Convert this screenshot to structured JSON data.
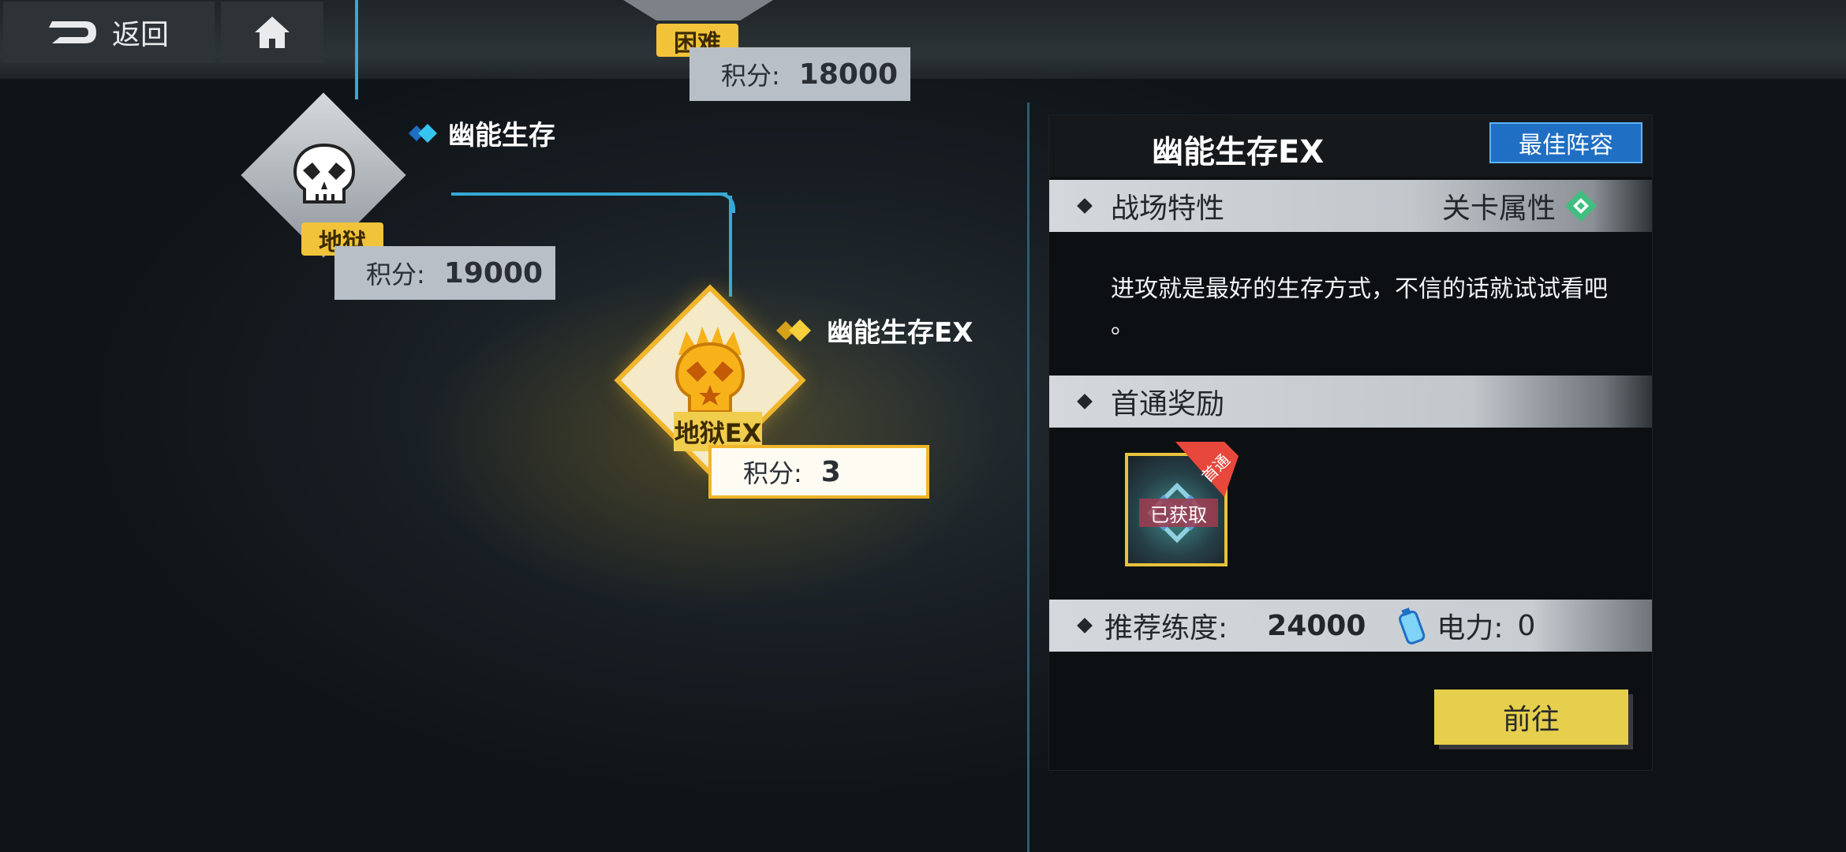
{
  "topbar": {
    "back_label": "返回",
    "home_icon": "home-icon",
    "back_icon": "back-arrow-icon"
  },
  "nodes": [
    {
      "name": "",
      "difficulty": "困难",
      "score_label": "积分:",
      "score": "18000"
    },
    {
      "name": "幽能生存",
      "difficulty": "地狱",
      "score_label": "积分:",
      "score": "19000"
    },
    {
      "name": "幽能生存EX",
      "difficulty": "地狱EX",
      "score_label": "积分:",
      "score": "3"
    }
  ],
  "panel": {
    "title": "幽能生存EX",
    "best_team_label": "最佳阵容",
    "battlefield_label": "战场特性",
    "stage_attr_label": "关卡属性",
    "description": "进攻就是最好的生存方式，不信的话就试试看吧",
    "description_tail": "。",
    "first_clear_label": "首通奖励",
    "reward_ribbon": "首通",
    "reward_status": "已获取",
    "recommend_label": "推荐练度:",
    "recommend_value": "24000",
    "power_label": "电力:",
    "power_value": "0",
    "go_label": "前往"
  },
  "colors": {
    "accent_yellow": "#f1c33a",
    "path_blue": "#36a9d4",
    "best_team_blue": "#1f6fc4",
    "attr_green": "#3fbf7f"
  }
}
